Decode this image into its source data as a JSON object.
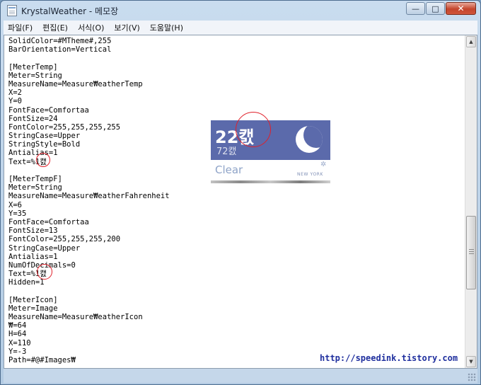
{
  "window": {
    "title": "KrystalWeather - 메모장",
    "icon": "notepad-icon",
    "buttons": {
      "minimize": "—",
      "maximize": "□",
      "close": "✕"
    }
  },
  "menu": [
    "파일(F)",
    "편집(E)",
    "서식(O)",
    "보기(V)",
    "도움말(H)"
  ],
  "editor": {
    "lines": [
      "SolidColor=#MTheme#,255",
      "BarOrientation=Vertical",
      "",
      "[MeterTemp]",
      "Meter=String",
      "MeasureName=Measure₩eatherTemp",
      "X=2",
      "Y=0",
      "FontFace=Comfortaa",
      "FontSize=24",
      "FontColor=255,255,255,255",
      "StringCase=Upper",
      "StringStyle=Bold",
      "Antialias=1",
      "Text=%1캜",
      "",
      "[MeterTempF]",
      "Meter=String",
      "MeasureName=Measure₩eatherFahrenheit",
      "X=6",
      "Y=35",
      "FontFace=Comfortaa",
      "FontSize=13",
      "FontColor=255,255,255,200",
      "StringCase=Upper",
      "Antialias=1",
      "NumOfDecimals=0",
      "Text=%1캜",
      "Hidden=1",
      "",
      "[MeterIcon]",
      "Meter=Image",
      "MeasureName=Measure₩eatherIcon",
      "₩=64",
      "H=64",
      "X=110",
      "Y=-3",
      "Path=#@#Images₩"
    ]
  },
  "weather_widget": {
    "temp_big": "22캜",
    "temp_small": "72캜",
    "condition": "Clear",
    "city": "NEW YORK",
    "settings_icon": "gear-icon",
    "accent_color": "#5b6aab"
  },
  "watermark": "http://speedink.tistory.com"
}
